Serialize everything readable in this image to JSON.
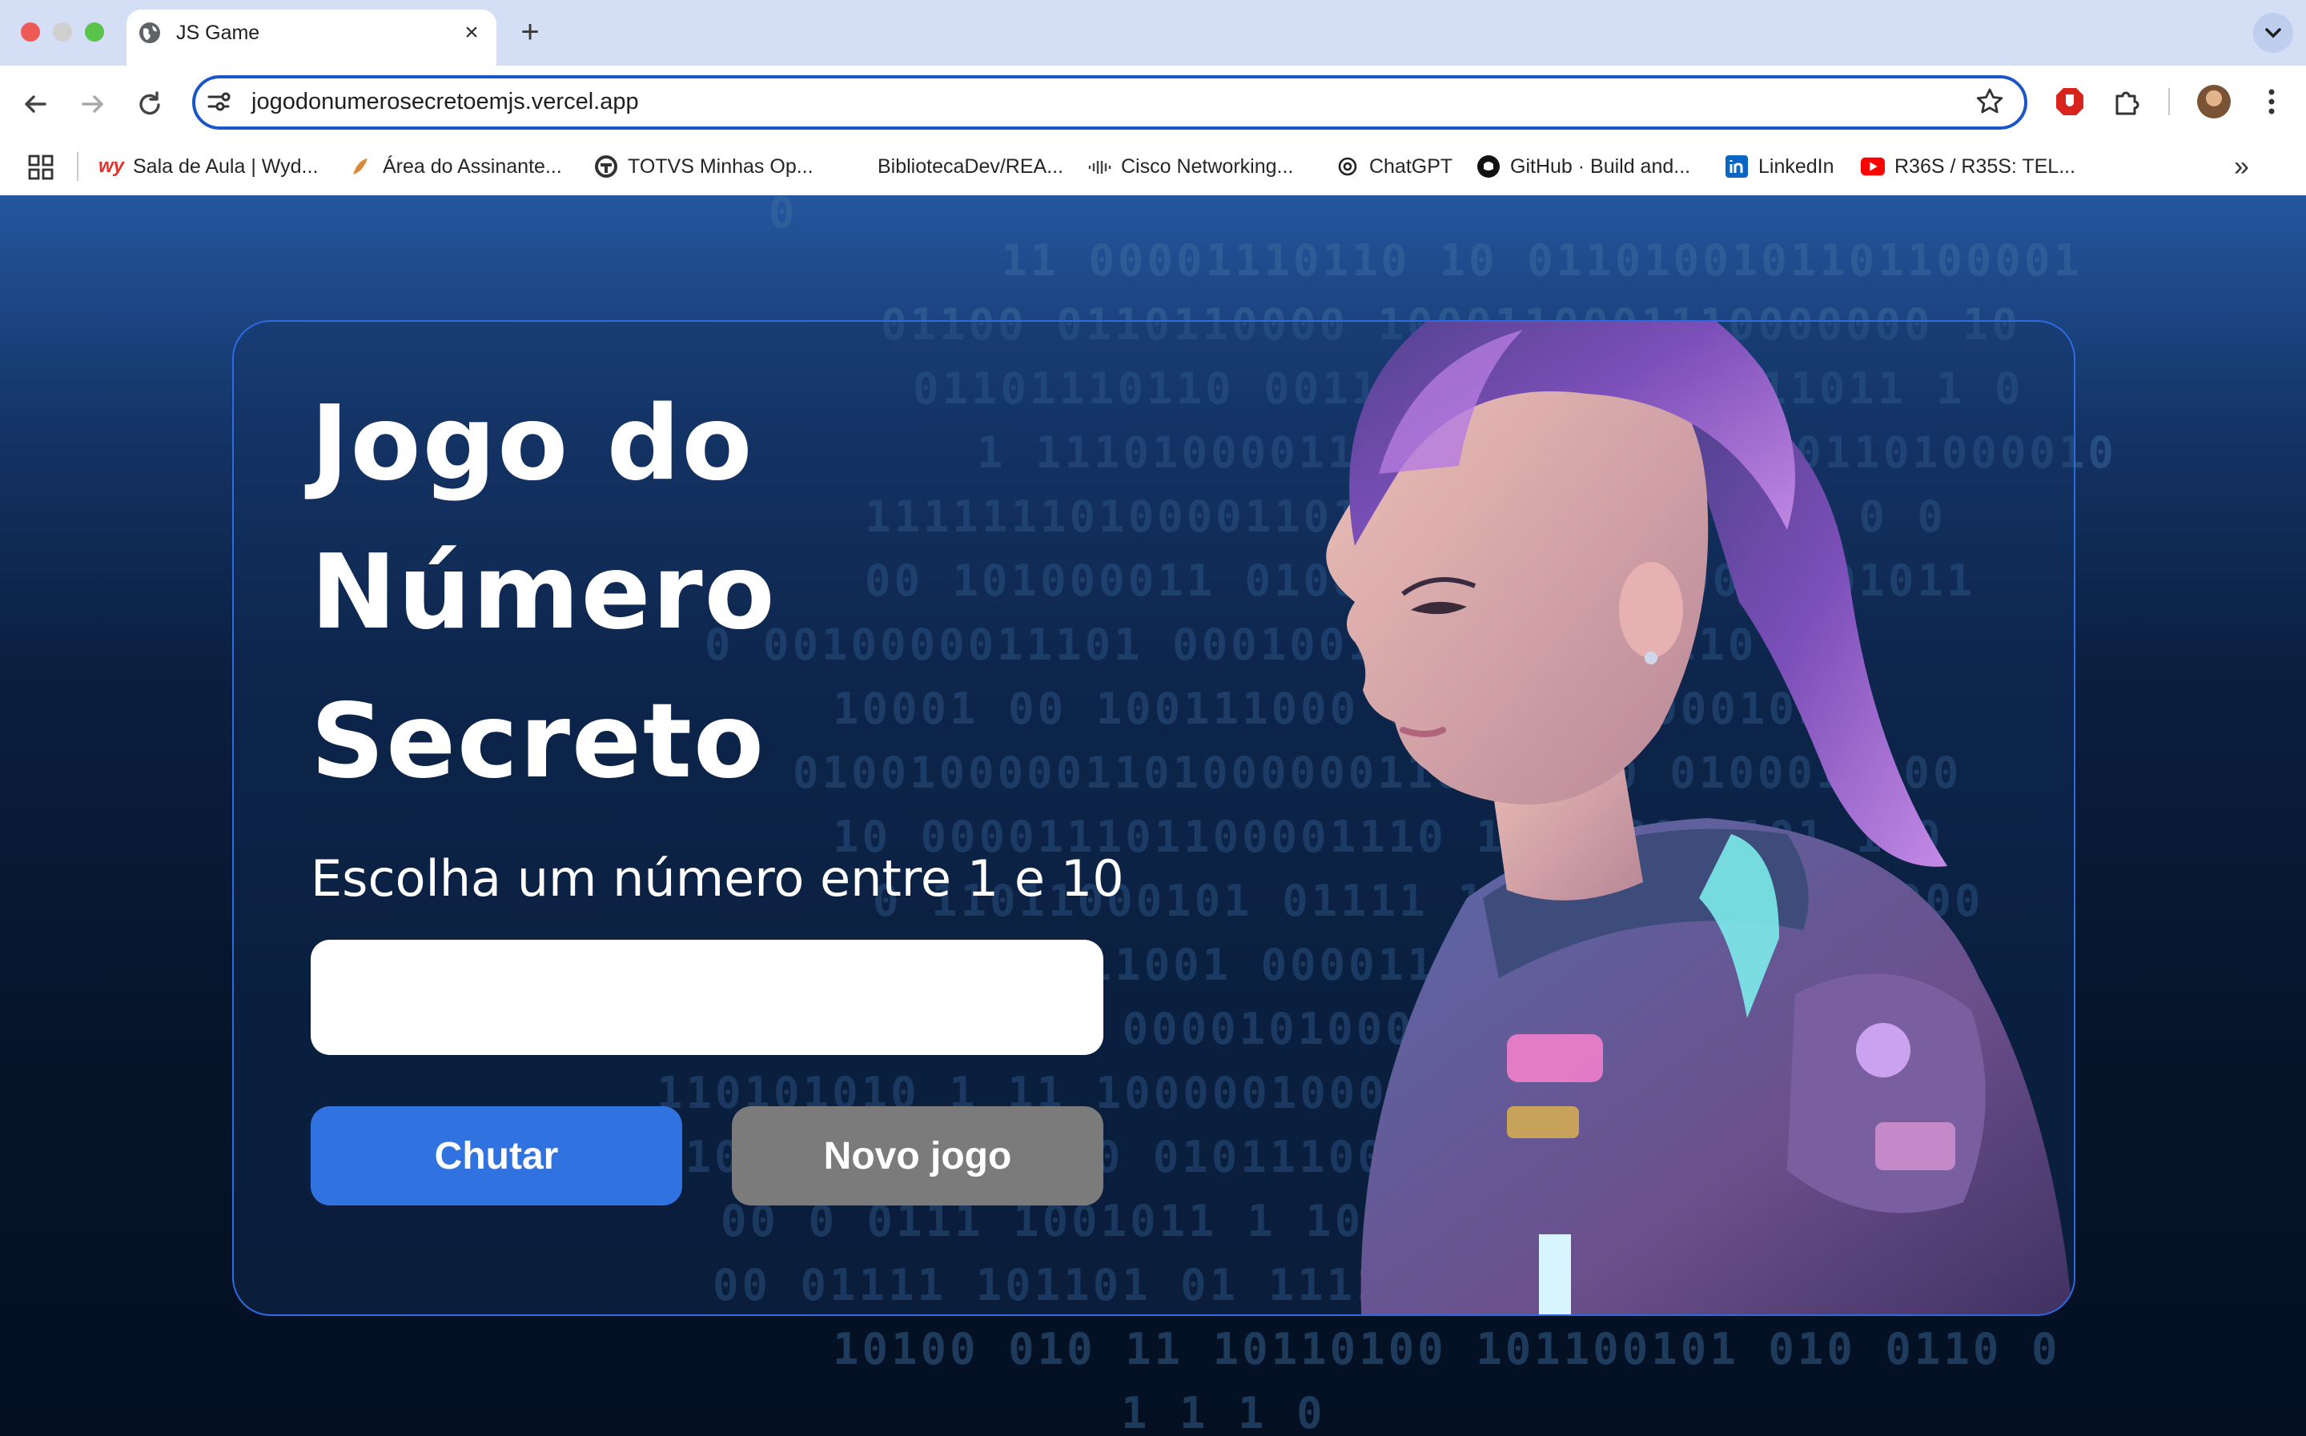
{
  "browser": {
    "tab_title": "JS Game",
    "url": "jogodonumerosecretoemjs.vercel.app",
    "bookmarks": [
      {
        "label": "Sala de Aula | Wyd...",
        "icon": "wyden-icon"
      },
      {
        "label": "Área do Assinante...",
        "icon": "bird-icon"
      },
      {
        "label": "TOTVS Minhas Op...",
        "icon": "totvs-icon"
      },
      {
        "label": "BibliotecaDev/REA...",
        "icon": ""
      },
      {
        "label": "Cisco Networking...",
        "icon": "cisco-icon"
      },
      {
        "label": "ChatGPT",
        "icon": "chatgpt-icon"
      },
      {
        "label": "GitHub · Build and...",
        "icon": "github-icon"
      },
      {
        "label": "LinkedIn",
        "icon": "linkedin-icon"
      },
      {
        "label": "R36S / R35S: TEL...",
        "icon": "youtube-icon"
      }
    ],
    "more_bookmarks": "»"
  },
  "game": {
    "title_line1": "Jogo do",
    "title_line2": "Número",
    "title_line3": "Secreto",
    "instruction": "Escolha um número entre 1 e 10",
    "input_value": "",
    "guess_button": "Chutar",
    "new_game_button": "Novo jogo"
  },
  "background_binary": [
    "0",
    "11 00001110110 10 0110100101101100001",
    "01100 0110110000 1000110001110000000 10",
    "01101110110 0011110011100110111011 1 0",
    "1 11101000011110 1100001110101101000010",
    "111111101000011011101100110000011 0 0",
    "00 101000011 010011011110110001 001011",
    "0 0010000011101 000100110 1010 10110 0",
    "10001 00 100111000 110110000000101",
    "01001000001101000000110001010 0100011 00",
    "10 000011101100001110 101110001101 1 0",
    "0 11011000101 01111 1000111110101 1000",
    "110001 11001 00001101100001101 11 10",
    "0001100011 000010100000110111111 10",
    "110101010 1 11 1000001000101 11 1001",
    "000001110  10110 000000 01011100101 1 1",
    "00 0 0111 1001011 1 1011101 10011 0",
    "00 01111  101101 01 1111 0110011 0 1",
    "10100 010 11 10110100 101100101 010 0110 0",
    "1 1 1 0"
  ],
  "colors": {
    "accent": "#2f72e0",
    "secondary_button": "#7b7b7b",
    "container_border": "#2f6be0"
  }
}
